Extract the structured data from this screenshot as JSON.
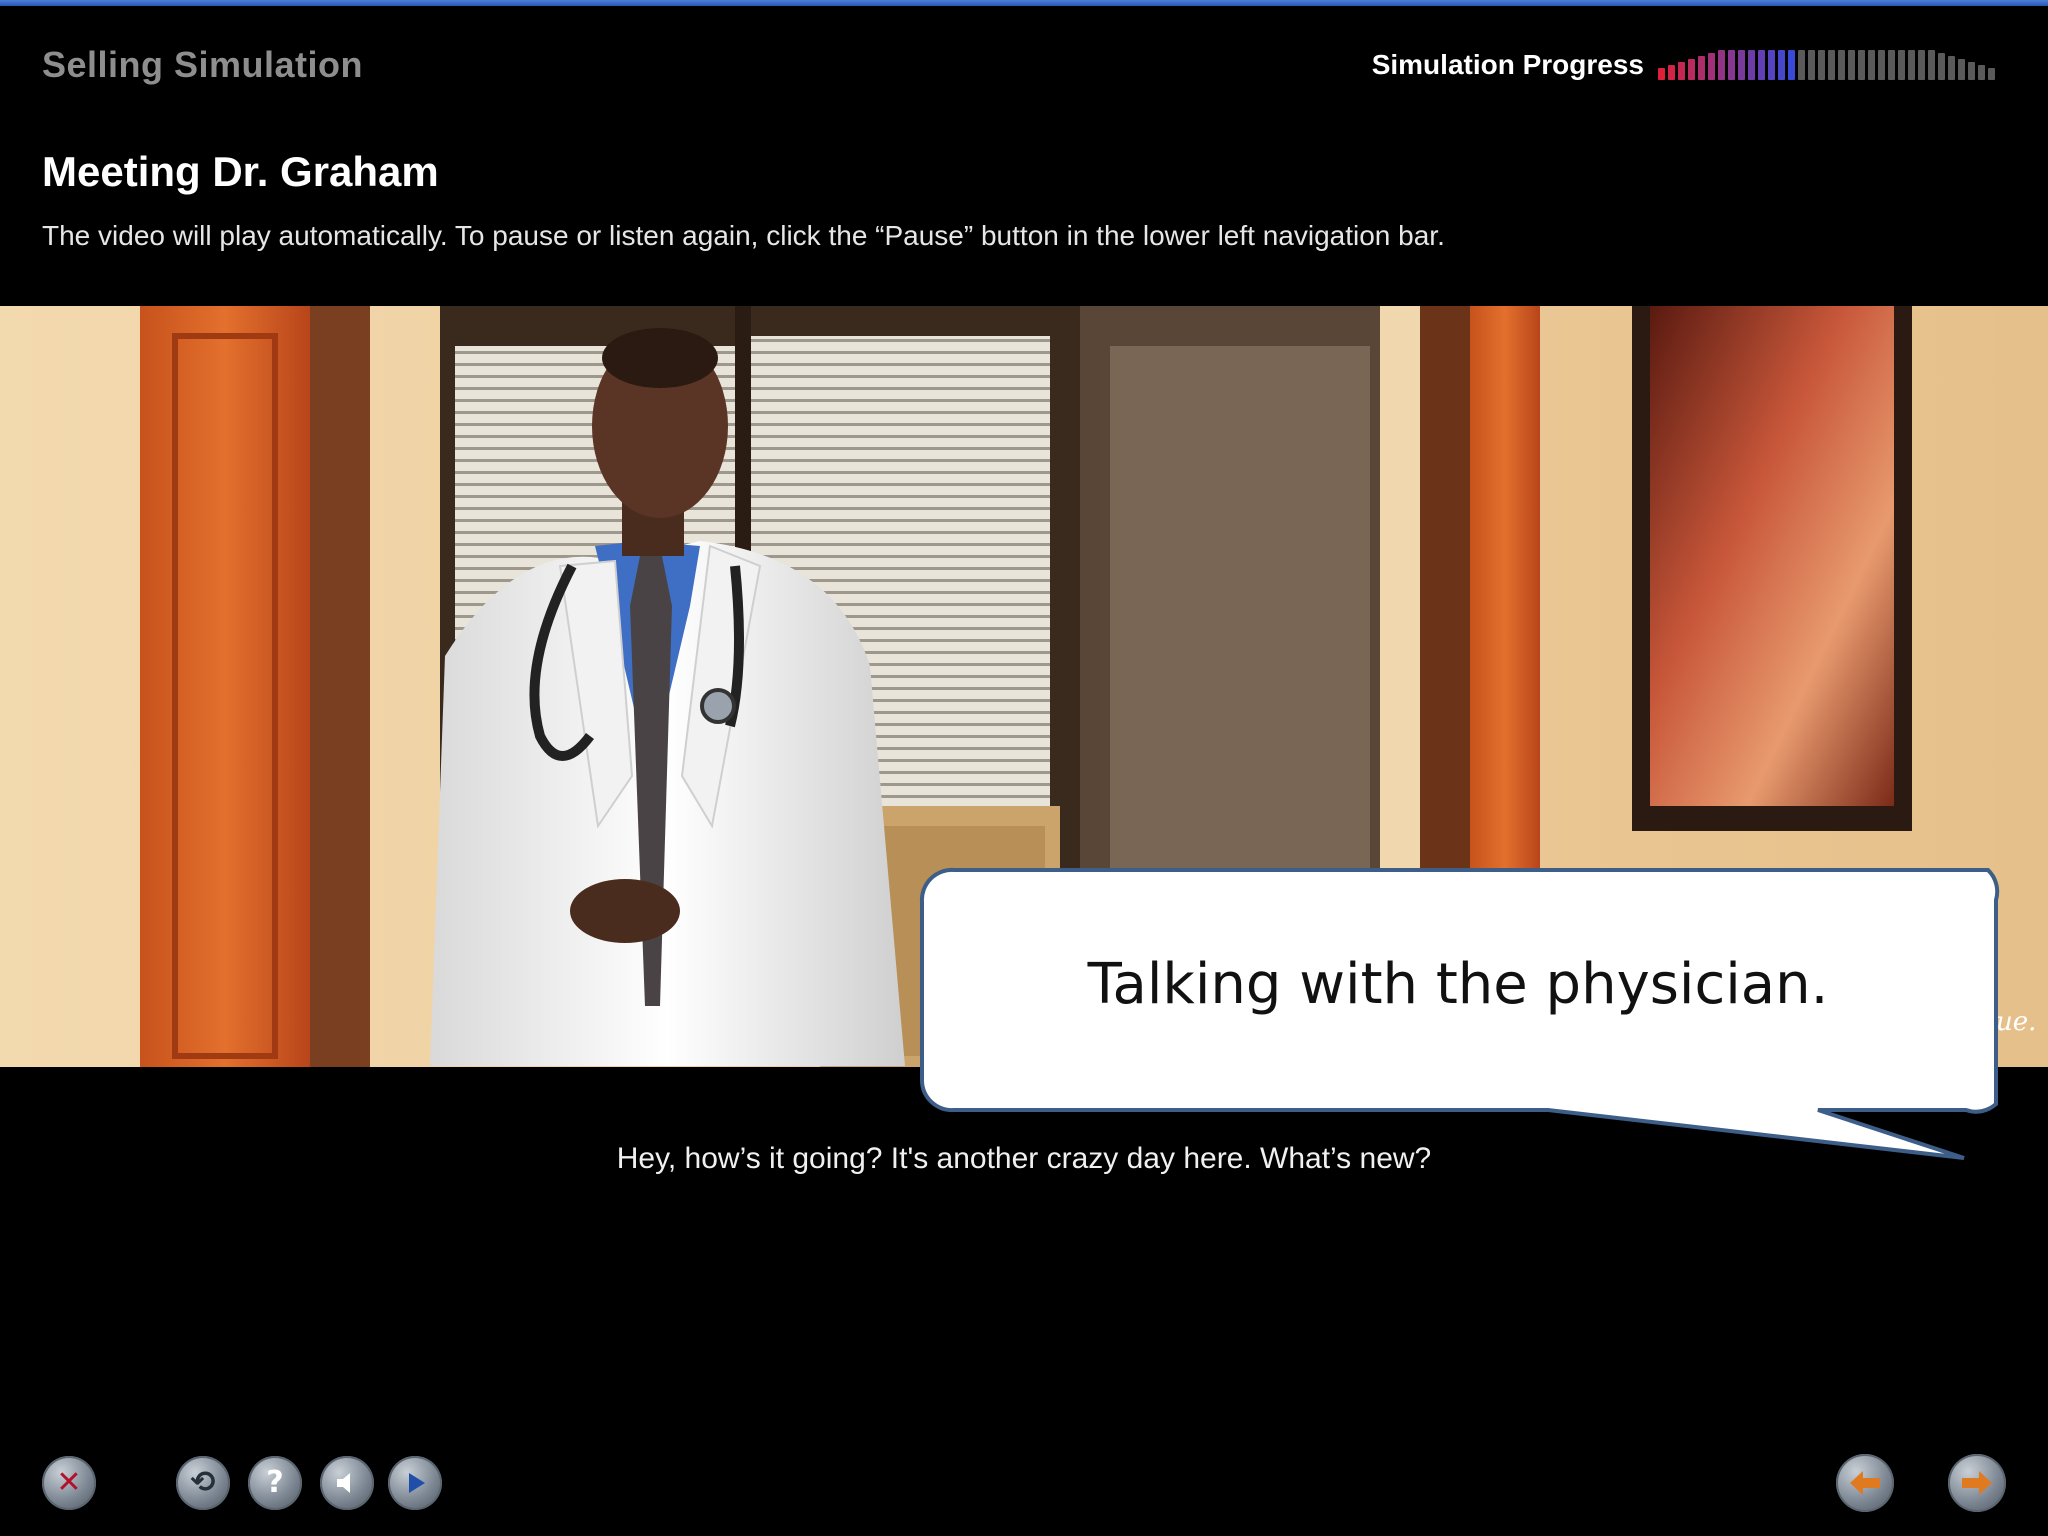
{
  "header": {
    "app_title": "Selling Simulation",
    "progress_label": "Simulation Progress",
    "progress_completed_fraction": 0.4
  },
  "scene": {
    "title": "Meeting Dr. Graham",
    "instructions": "The video will play automatically. To pause or listen again, click the “Pause” button in the lower left navigation bar."
  },
  "video": {
    "caption": "Hey, how’s it going? It's another crazy day here. What’s new?"
  },
  "callout": {
    "text": "Talking with the physician."
  },
  "nav": {
    "buttons": [
      {
        "name": "close-button",
        "icon": "close-icon"
      },
      {
        "name": "replay-button",
        "icon": "replay-icon"
      },
      {
        "name": "help-button",
        "icon": "help-icon"
      },
      {
        "name": "audio-button",
        "icon": "speaker-icon"
      },
      {
        "name": "play-button",
        "icon": "play-icon"
      },
      {
        "name": "back-button",
        "icon": "arrow-left-icon"
      },
      {
        "name": "next-button",
        "icon": "arrow-right-icon"
      }
    ]
  },
  "colors": {
    "background": "#000000",
    "progress_done_start": "#e0203a",
    "progress_done_end": "#3a4ad8",
    "progress_remaining": "#5a5a5a",
    "nav_close_glyph": "#b0122a",
    "nav_arrow_glyph": "#e07a20",
    "callout_border": "#3c5e88"
  }
}
